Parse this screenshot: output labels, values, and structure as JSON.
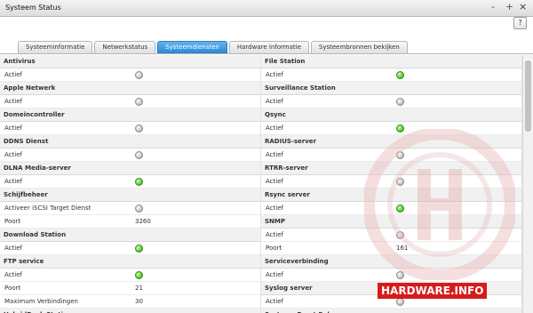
{
  "window": {
    "title": "Systeem Status",
    "controls": [
      "-",
      "+",
      "×"
    ],
    "help": "?"
  },
  "tabs": [
    {
      "label": "Systeeminformatie",
      "active": false
    },
    {
      "label": "Netwerkstatus",
      "active": false
    },
    {
      "label": "Systeemdiensten",
      "active": true
    },
    {
      "label": "Hardware informatie",
      "active": false
    },
    {
      "label": "Systeembronnen bekijken",
      "active": false
    }
  ],
  "columns": [
    [
      {
        "title": "Antivirus",
        "rows": [
          {
            "label": "Actief",
            "status": "gray"
          }
        ]
      },
      {
        "title": "Apple Netwerk",
        "rows": [
          {
            "label": "Actief",
            "status": "gray"
          }
        ]
      },
      {
        "title": "Domeincontroller",
        "rows": [
          {
            "label": "Actief",
            "status": "gray"
          }
        ]
      },
      {
        "title": "DDNS Dienst",
        "rows": [
          {
            "label": "Actief",
            "status": "gray"
          }
        ]
      },
      {
        "title": "DLNA Media-server",
        "rows": [
          {
            "label": "Actief",
            "status": "green"
          }
        ]
      },
      {
        "title": "Schijfbeheer",
        "rows": [
          {
            "label": "Activeer iSCSI Target Dienst",
            "status": "gray"
          },
          {
            "label": "Poort",
            "value": "3260"
          }
        ]
      },
      {
        "title": "Download Station",
        "rows": [
          {
            "label": "Actief",
            "status": "green"
          }
        ]
      },
      {
        "title": "FTP service",
        "rows": [
          {
            "label": "Actief",
            "status": "green"
          },
          {
            "label": "Poort",
            "value": "21"
          },
          {
            "label": "Maximum Verbindingen",
            "value": "30"
          }
        ]
      },
      {
        "title": "HybridDesk Station",
        "rows": []
      }
    ],
    [
      {
        "title": "File Station",
        "rows": [
          {
            "label": "Actief",
            "status": "green"
          }
        ]
      },
      {
        "title": "Surveillance Station",
        "rows": [
          {
            "label": "Actief",
            "status": "gray"
          }
        ]
      },
      {
        "title": "Qsync",
        "rows": [
          {
            "label": "Actief",
            "status": "green"
          }
        ]
      },
      {
        "title": "RADIUS-server",
        "rows": [
          {
            "label": "Actief",
            "status": "gray"
          }
        ]
      },
      {
        "title": "RTRR-server",
        "rows": [
          {
            "label": "Actief",
            "status": "gray"
          }
        ]
      },
      {
        "title": "Rsync server",
        "rows": [
          {
            "label": "Actief",
            "status": "green"
          }
        ]
      },
      {
        "title": "SNMP",
        "rows": [
          {
            "label": "Actief",
            "status": "gray"
          },
          {
            "label": "Poort",
            "value": "161"
          }
        ]
      },
      {
        "title": "Serviceverbinding",
        "rows": [
          {
            "label": "Actief",
            "status": "gray"
          }
        ]
      },
      {
        "title": "Syslog server",
        "rows": [
          {
            "label": "Actief",
            "status": "gray"
          }
        ]
      },
      {
        "title": "Systeem Poort Beheer",
        "rows": []
      }
    ]
  ],
  "watermark": {
    "text": "HARDWARE.INFO"
  },
  "colors": {
    "accent": "#2a86d5",
    "status_on": "#4fd02a",
    "status_off": "#c4c4c4",
    "watermark": "#d71b1b"
  }
}
